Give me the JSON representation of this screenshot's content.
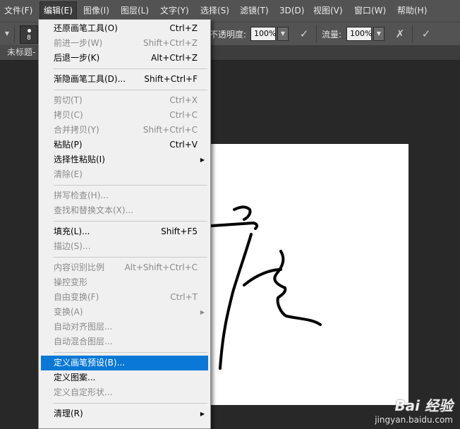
{
  "menubar": [
    {
      "label": "文件(F)",
      "active": false
    },
    {
      "label": "编辑(E)",
      "active": true
    },
    {
      "label": "图像(I)",
      "active": false
    },
    {
      "label": "图层(L)",
      "active": false
    },
    {
      "label": "文字(Y)",
      "active": false
    },
    {
      "label": "选择(S)",
      "active": false
    },
    {
      "label": "滤镜(T)",
      "active": false
    },
    {
      "label": "3D(D)",
      "active": false
    },
    {
      "label": "视图(V)",
      "active": false
    },
    {
      "label": "窗口(W)",
      "active": false
    },
    {
      "label": "帮助(H)",
      "active": false
    }
  ],
  "options": {
    "brush_size": "8",
    "opacity_label": "不透明度:",
    "opacity_value": "100%",
    "flow_label": "流量:",
    "flow_value": "100%"
  },
  "document_tab": {
    "label": "未标题-"
  },
  "edit_menu": [
    {
      "label": "还原画笔工具(O)",
      "shortcut": "Ctrl+Z",
      "enabled": true
    },
    {
      "label": "前进一步(W)",
      "shortcut": "Shift+Ctrl+Z",
      "enabled": false
    },
    {
      "label": "后退一步(K)",
      "shortcut": "Alt+Ctrl+Z",
      "enabled": true
    },
    {
      "separator": true
    },
    {
      "label": "渐隐画笔工具(D)...",
      "shortcut": "Shift+Ctrl+F",
      "enabled": true
    },
    {
      "separator": true
    },
    {
      "label": "剪切(T)",
      "shortcut": "Ctrl+X",
      "enabled": false
    },
    {
      "label": "拷贝(C)",
      "shortcut": "Ctrl+C",
      "enabled": false
    },
    {
      "label": "合并拷贝(Y)",
      "shortcut": "Shift+Ctrl+C",
      "enabled": false
    },
    {
      "label": "粘贴(P)",
      "shortcut": "Ctrl+V",
      "enabled": true
    },
    {
      "label": "选择性粘贴(I)",
      "shortcut": "",
      "enabled": true,
      "submenu": true
    },
    {
      "label": "清除(E)",
      "shortcut": "",
      "enabled": false
    },
    {
      "separator": true
    },
    {
      "label": "拼写检查(H)...",
      "shortcut": "",
      "enabled": false
    },
    {
      "label": "查找和替换文本(X)...",
      "shortcut": "",
      "enabled": false
    },
    {
      "separator": true
    },
    {
      "label": "填充(L)...",
      "shortcut": "Shift+F5",
      "enabled": true
    },
    {
      "label": "描边(S)...",
      "shortcut": "",
      "enabled": false
    },
    {
      "separator": true
    },
    {
      "label": "内容识别比例",
      "shortcut": "Alt+Shift+Ctrl+C",
      "enabled": false
    },
    {
      "label": "操控变形",
      "shortcut": "",
      "enabled": false
    },
    {
      "label": "自由变换(F)",
      "shortcut": "Ctrl+T",
      "enabled": false
    },
    {
      "label": "变换(A)",
      "shortcut": "",
      "enabled": false,
      "submenu": true
    },
    {
      "label": "自动对齐图层...",
      "shortcut": "",
      "enabled": false
    },
    {
      "label": "自动混合图层...",
      "shortcut": "",
      "enabled": false
    },
    {
      "separator": true
    },
    {
      "label": "定义画笔预设(B)...",
      "shortcut": "",
      "enabled": true,
      "highlighted": true
    },
    {
      "label": "定义图案...",
      "shortcut": "",
      "enabled": true
    },
    {
      "label": "定义自定形状...",
      "shortcut": "",
      "enabled": false
    },
    {
      "separator": true
    },
    {
      "label": "清理(R)",
      "shortcut": "",
      "enabled": true,
      "submenu": true
    }
  ],
  "watermark": {
    "line1": "Bai 经验",
    "line2": "jingyan.baidu.com"
  },
  "colors": {
    "highlight": "#0a78d7",
    "menu_bg": "#f0f0f0",
    "menubar_bg": "#535353",
    "workspace_bg": "#282828"
  }
}
